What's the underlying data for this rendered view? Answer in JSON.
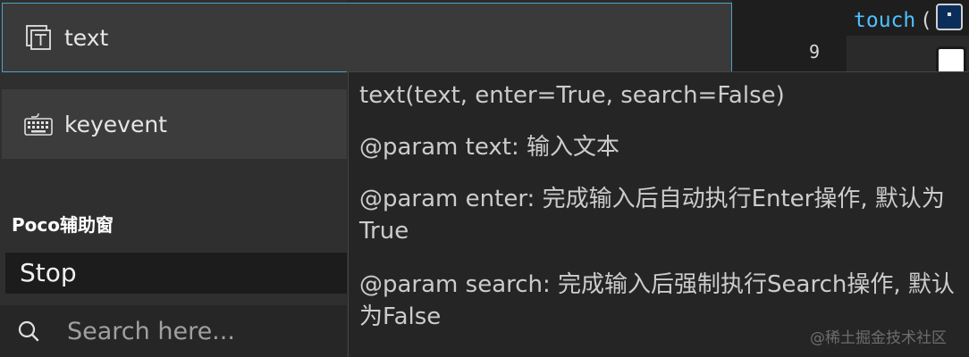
{
  "api_buttons": [
    {
      "label": "text",
      "icon": "text-box-icon"
    },
    {
      "label": "keyevent",
      "icon": "keyboard-icon"
    }
  ],
  "aux_panel": {
    "title": "Poco辅助窗",
    "stop_label": "Stop"
  },
  "search": {
    "placeholder": "Search here...",
    "icon": "search-icon"
  },
  "editor": {
    "line_number": "9",
    "code": "touch",
    "paren": "("
  },
  "tooltip": {
    "signature": "text(text, enter=True, search=False)",
    "params": [
      "@param text: 输入文本",
      "@param enter: 完成输入后自动执行Enter操作, 默认为True",
      "@param search: 完成输入后强制执行Search操作, 默认为False"
    ]
  },
  "watermark": "@稀土掘金技术社区",
  "colors": {
    "accent_border": "#4ea1c7",
    "code_keyword": "#4fc1ff",
    "panel_bg": "#2f2f2f",
    "tooltip_bg": "#252526"
  }
}
